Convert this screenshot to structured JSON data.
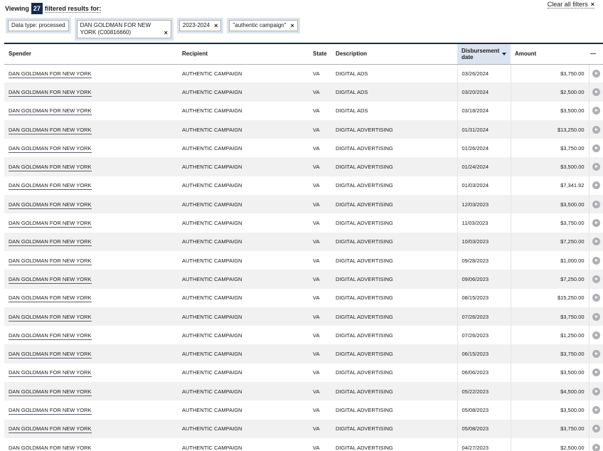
{
  "header": {
    "viewing_label": "Viewing",
    "count": "27",
    "filtered_label": "filtered results for:",
    "clear_all_label": "Clear all filters",
    "clear_icon": "×"
  },
  "tags": [
    {
      "label": "Data type: processed",
      "removable": false
    },
    {
      "label": "DAN GOLDMAN FOR NEW YORK (C00816660)",
      "removable": true
    },
    {
      "label": "2023-2024",
      "removable": true
    },
    {
      "label": "\"authentic campaign\"",
      "removable": true
    }
  ],
  "table": {
    "columns": [
      "Spender",
      "Recipient",
      "State",
      "Description",
      "Disbursement date",
      "Amount",
      "—"
    ],
    "rows": [
      {
        "spender": "DAN GOLDMAN FOR NEW YORK",
        "recipient": "AUTHENTIC CAMPAIGN",
        "state": "VA",
        "description": "DIGITAL ADS",
        "date": "03/26/2024",
        "amount": "$3,750.00"
      },
      {
        "spender": "DAN GOLDMAN FOR NEW YORK",
        "recipient": "AUTHENTIC CAMPAIGN",
        "state": "VA",
        "description": "DIGITAL ADS",
        "date": "03/20/2024",
        "amount": "$2,500.00"
      },
      {
        "spender": "DAN GOLDMAN FOR NEW YORK",
        "recipient": "AUTHENTIC CAMPAIGN",
        "state": "VA",
        "description": "DIGITAL ADS",
        "date": "03/18/2024",
        "amount": "$3,500.00"
      },
      {
        "spender": "DAN GOLDMAN FOR NEW YORK",
        "recipient": "AUTHENTIC CAMPAIGN",
        "state": "VA",
        "description": "DIGITAL ADVERTISING",
        "date": "01/31/2024",
        "amount": "$13,250.00"
      },
      {
        "spender": "DAN GOLDMAN FOR NEW YORK",
        "recipient": "AUTHENTIC CAMPAIGN",
        "state": "VA",
        "description": "DIGITAL ADVERTISING",
        "date": "01/26/2024",
        "amount": "$3,750.00"
      },
      {
        "spender": "DAN GOLDMAN FOR NEW YORK",
        "recipient": "AUTHENTIC CAMPAIGN",
        "state": "VA",
        "description": "DIGITAL ADVERTISING",
        "date": "01/24/2024",
        "amount": "$3,500.00"
      },
      {
        "spender": "DAN GOLDMAN FOR NEW YORK",
        "recipient": "AUTHENTIC CAMPAIGN",
        "state": "VA",
        "description": "DIGITAL ADVERTISING",
        "date": "01/03/2024",
        "amount": "$7,341.92"
      },
      {
        "spender": "DAN GOLDMAN FOR NEW YORK",
        "recipient": "AUTHENTIC CAMPAIGN",
        "state": "VA",
        "description": "DIGITAL ADVERTISING",
        "date": "12/03/2023",
        "amount": "$3,500.00"
      },
      {
        "spender": "DAN GOLDMAN FOR NEW YORK",
        "recipient": "AUTHENTIC CAMPAIGN",
        "state": "VA",
        "description": "DIGITAL ADVERTISING",
        "date": "11/03/2023",
        "amount": "$3,750.00"
      },
      {
        "spender": "DAN GOLDMAN FOR NEW YORK",
        "recipient": "AUTHENTIC CAMPAIGN",
        "state": "VA",
        "description": "DIGITAL ADVERTISING",
        "date": "10/03/2023",
        "amount": "$7,250.00"
      },
      {
        "spender": "DAN GOLDMAN FOR NEW YORK",
        "recipient": "AUTHENTIC CAMPAIGN",
        "state": "VA",
        "description": "DIGITAL ADVERTISING",
        "date": "09/28/2023",
        "amount": "$1,000.00"
      },
      {
        "spender": "DAN GOLDMAN FOR NEW YORK",
        "recipient": "AUTHENTIC CAMPAIGN",
        "state": "VA",
        "description": "DIGITAL ADVERTISING",
        "date": "09/06/2023",
        "amount": "$7,250.00"
      },
      {
        "spender": "DAN GOLDMAN FOR NEW YORK",
        "recipient": "AUTHENTIC CAMPAIGN",
        "state": "VA",
        "description": "DIGITAL ADVERTISING",
        "date": "08/15/2023",
        "amount": "$15,250.00"
      },
      {
        "spender": "DAN GOLDMAN FOR NEW YORK",
        "recipient": "AUTHENTIC CAMPAIGN",
        "state": "VA",
        "description": "DIGITAL ADVERTISING",
        "date": "07/26/2023",
        "amount": "$3,750.00"
      },
      {
        "spender": "DAN GOLDMAN FOR NEW YORK",
        "recipient": "AUTHENTIC CAMPAIGN",
        "state": "VA",
        "description": "DIGITAL ADVERTISING",
        "date": "07/26/2023",
        "amount": "$1,250.00"
      },
      {
        "spender": "DAN GOLDMAN FOR NEW YORK",
        "recipient": "AUTHENTIC CAMPAIGN",
        "state": "VA",
        "description": "DIGITAL ADVERTISING",
        "date": "06/15/2023",
        "amount": "$3,750.00"
      },
      {
        "spender": "DAN GOLDMAN FOR NEW YORK",
        "recipient": "AUTHENTIC CAMPAIGN",
        "state": "VA",
        "description": "DIGITAL ADVERTISING",
        "date": "06/06/2023",
        "amount": "$3,500.00"
      },
      {
        "spender": "DAN GOLDMAN FOR NEW YORK",
        "recipient": "AUTHENTIC CAMPAIGN",
        "state": "VA",
        "description": "DIGITAL ADVERTISING",
        "date": "05/22/2023",
        "amount": "$4,500.00"
      },
      {
        "spender": "DAN GOLDMAN FOR NEW YORK",
        "recipient": "AUTHENTIC CAMPAIGN",
        "state": "VA",
        "description": "DIGITAL ADVERTISING",
        "date": "05/08/2023",
        "amount": "$3,500.00"
      },
      {
        "spender": "DAN GOLDMAN FOR NEW YORK",
        "recipient": "AUTHENTIC CAMPAIGN",
        "state": "VA",
        "description": "DIGITAL ADVERTISING",
        "date": "05/08/2023",
        "amount": "$3,750.00"
      },
      {
        "spender": "DAN GOLDMAN FOR NEW YORK",
        "recipient": "AUTHENTIC CAMPAIGN",
        "state": "VA",
        "description": "DIGITAL ADVERTISING",
        "date": "04/27/2023",
        "amount": "$2,500.00"
      }
    ]
  }
}
